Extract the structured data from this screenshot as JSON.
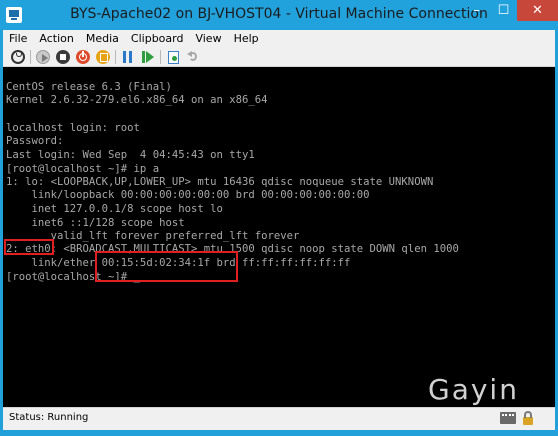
{
  "window": {
    "title": "BYS-Apache02 on BJ-VHOST04 - Virtual Machine Connection",
    "controls": {
      "minimize": "–",
      "maximize": "☐",
      "close": "✕"
    }
  },
  "menu": {
    "items": [
      "File",
      "Action",
      "Media",
      "Clipboard",
      "View",
      "Help"
    ]
  },
  "toolbar": {
    "icons": [
      "ctrl-alt-del-icon",
      "start-icon",
      "turn-off-icon",
      "shut-down-icon",
      "save-icon",
      "pause-icon",
      "reset-icon",
      "checkpoint-icon",
      "revert-icon"
    ]
  },
  "console": {
    "lines": [
      "CentOS release 6.3 (Final)",
      "Kernel 2.6.32-279.el6.x86_64 on an x86_64",
      "",
      "localhost login: root",
      "Password:",
      "Last login: Wed Sep  4 04:45:43 on tty1",
      "[root@localhost ~]# ip a",
      "1: lo: <LOOPBACK,UP,LOWER_UP> mtu 16436 qdisc noqueue state UNKNOWN",
      "    link/loopback 00:00:00:00:00:00 brd 00:00:00:00:00:00",
      "    inet 127.0.0.1/8 scope host lo",
      "    inet6 ::1/128 scope host",
      "       valid_lft forever preferred_lft forever",
      "2: eth0: <BROADCAST,MULTICAST> mtu 1500 qdisc noop state DOWN qlen 1000",
      "    link/ether 00:15:5d:02:34:1f brd ff:ff:ff:ff:ff:ff",
      "[root@localhost ~]# _"
    ],
    "highlight_color": "#e02020"
  },
  "watermark": "Gayin",
  "status": {
    "text": "Status: Running",
    "icons": [
      "keyboard-icon",
      "lock-icon"
    ]
  },
  "colors": {
    "frame": "#21a0d9",
    "close_button": "#c7473b",
    "console_bg": "#000000",
    "console_text": "#a8a8a8"
  }
}
